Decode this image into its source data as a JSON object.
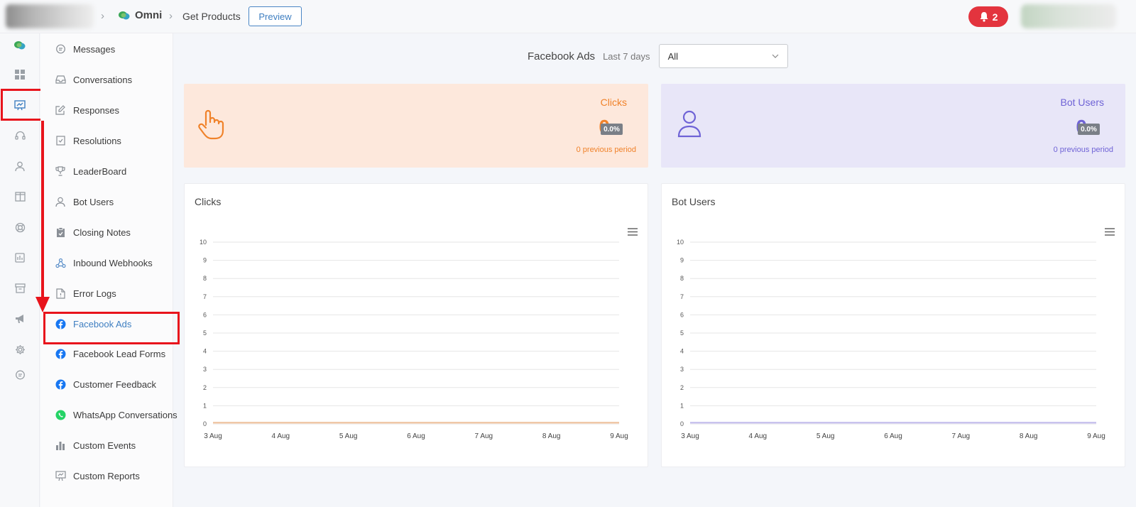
{
  "topbar": {
    "app_name": "Omni",
    "page": "Get Products",
    "preview_label": "Preview",
    "notification_count": "2"
  },
  "rail": {
    "icons": [
      "chat-logo-icon",
      "dashboard-icon",
      "analytics-icon",
      "headset-icon",
      "user-icon",
      "columns-icon",
      "lifebuoy-icon",
      "report-icon",
      "archive-icon",
      "megaphone-icon",
      "gear-icon",
      "message-icon"
    ],
    "active": "analytics-icon"
  },
  "submenu": {
    "items": [
      {
        "label": "Messages",
        "icon": "message-icon"
      },
      {
        "label": "Conversations",
        "icon": "inbox-icon"
      },
      {
        "label": "Responses",
        "icon": "edit-icon"
      },
      {
        "label": "Resolutions",
        "icon": "check-doc-icon"
      },
      {
        "label": "LeaderBoard",
        "icon": "trophy-icon"
      },
      {
        "label": "Bot Users",
        "icon": "user-icon"
      },
      {
        "label": "Closing Notes",
        "icon": "clipboard-icon"
      },
      {
        "label": "Inbound Webhooks",
        "icon": "webhook-icon"
      },
      {
        "label": "Error Logs",
        "icon": "error-doc-icon"
      },
      {
        "label": "Facebook Ads",
        "icon": "facebook-icon"
      },
      {
        "label": "Facebook Lead Forms",
        "icon": "facebook-icon"
      },
      {
        "label": "Customer Feedback",
        "icon": "facebook-icon"
      },
      {
        "label": "WhatsApp Conversations",
        "icon": "whatsapp-icon"
      },
      {
        "label": "Custom Events",
        "icon": "bar-chart-icon"
      },
      {
        "label": "Custom Reports",
        "icon": "presentation-icon"
      }
    ],
    "active": "Facebook Ads"
  },
  "filter": {
    "title": "Facebook Ads",
    "period": "Last 7 days",
    "selected": "All"
  },
  "stats": {
    "clicks": {
      "title": "Clicks",
      "value": "0",
      "change": "0.0%",
      "previous": "0 previous period",
      "color": "#f0822a"
    },
    "bot_users": {
      "title": "Bot Users",
      "value": "0",
      "change": "0.0%",
      "previous": "0 previous period",
      "color": "#6f63d6"
    }
  },
  "colors": {
    "accent_blue": "#3f7fc1",
    "highlight_red": "#e8141c",
    "clicks_bg": "#fde8dc",
    "bots_bg": "#e8e6f8"
  },
  "chart_data": [
    {
      "type": "area",
      "title": "Clicks",
      "categories": [
        "3 Aug",
        "4 Aug",
        "5 Aug",
        "6 Aug",
        "7 Aug",
        "8 Aug",
        "9 Aug"
      ],
      "series": [
        {
          "values": [
            0,
            0,
            0,
            0,
            0,
            0,
            0
          ],
          "color": "#f0c8a8"
        }
      ],
      "yticks": [
        "0",
        "1",
        "2",
        "3",
        "4",
        "5",
        "6",
        "7",
        "8",
        "9",
        "10"
      ],
      "ylim": [
        0,
        10
      ],
      "grid": true
    },
    {
      "type": "area",
      "title": "Bot Users",
      "categories": [
        "3 Aug",
        "4 Aug",
        "5 Aug",
        "6 Aug",
        "7 Aug",
        "8 Aug",
        "9 Aug"
      ],
      "series": [
        {
          "values": [
            0,
            0,
            0,
            0,
            0,
            0,
            0
          ],
          "color": "#c9c3ee"
        }
      ],
      "yticks": [
        "0",
        "1",
        "2",
        "3",
        "4",
        "5",
        "6",
        "7",
        "8",
        "9",
        "10"
      ],
      "ylim": [
        0,
        10
      ],
      "grid": true
    }
  ]
}
